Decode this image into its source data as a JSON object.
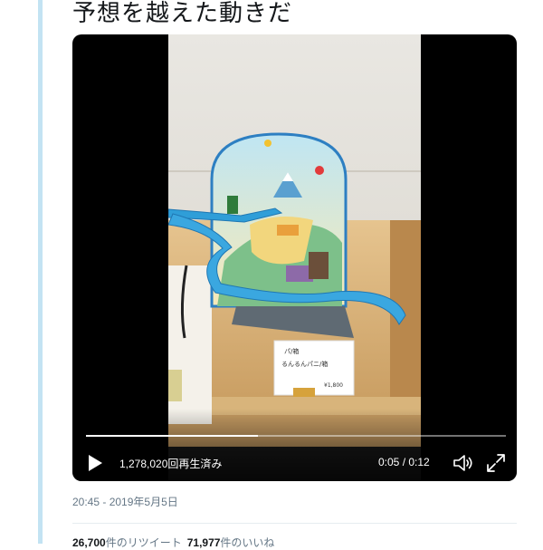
{
  "tweet": {
    "text": "予想を越えた動きだ",
    "timestamp": "20:45 - 2019年5月5日"
  },
  "video": {
    "views": "1,278,020回再生済み",
    "time": "0:05 / 0:12",
    "progress": 0.41,
    "card": {
      "line1": "パ/箱",
      "line2": "るんるんパニ/箱",
      "price": "¥1,800"
    }
  },
  "stats": {
    "retweets_count": "26,700",
    "retweets_label": "件のリツイート",
    "likes_count": "71,977",
    "likes_label": "件のいいね"
  },
  "colors": {
    "accent_rule": "#c3e3f3",
    "meta_text": "#657786"
  }
}
